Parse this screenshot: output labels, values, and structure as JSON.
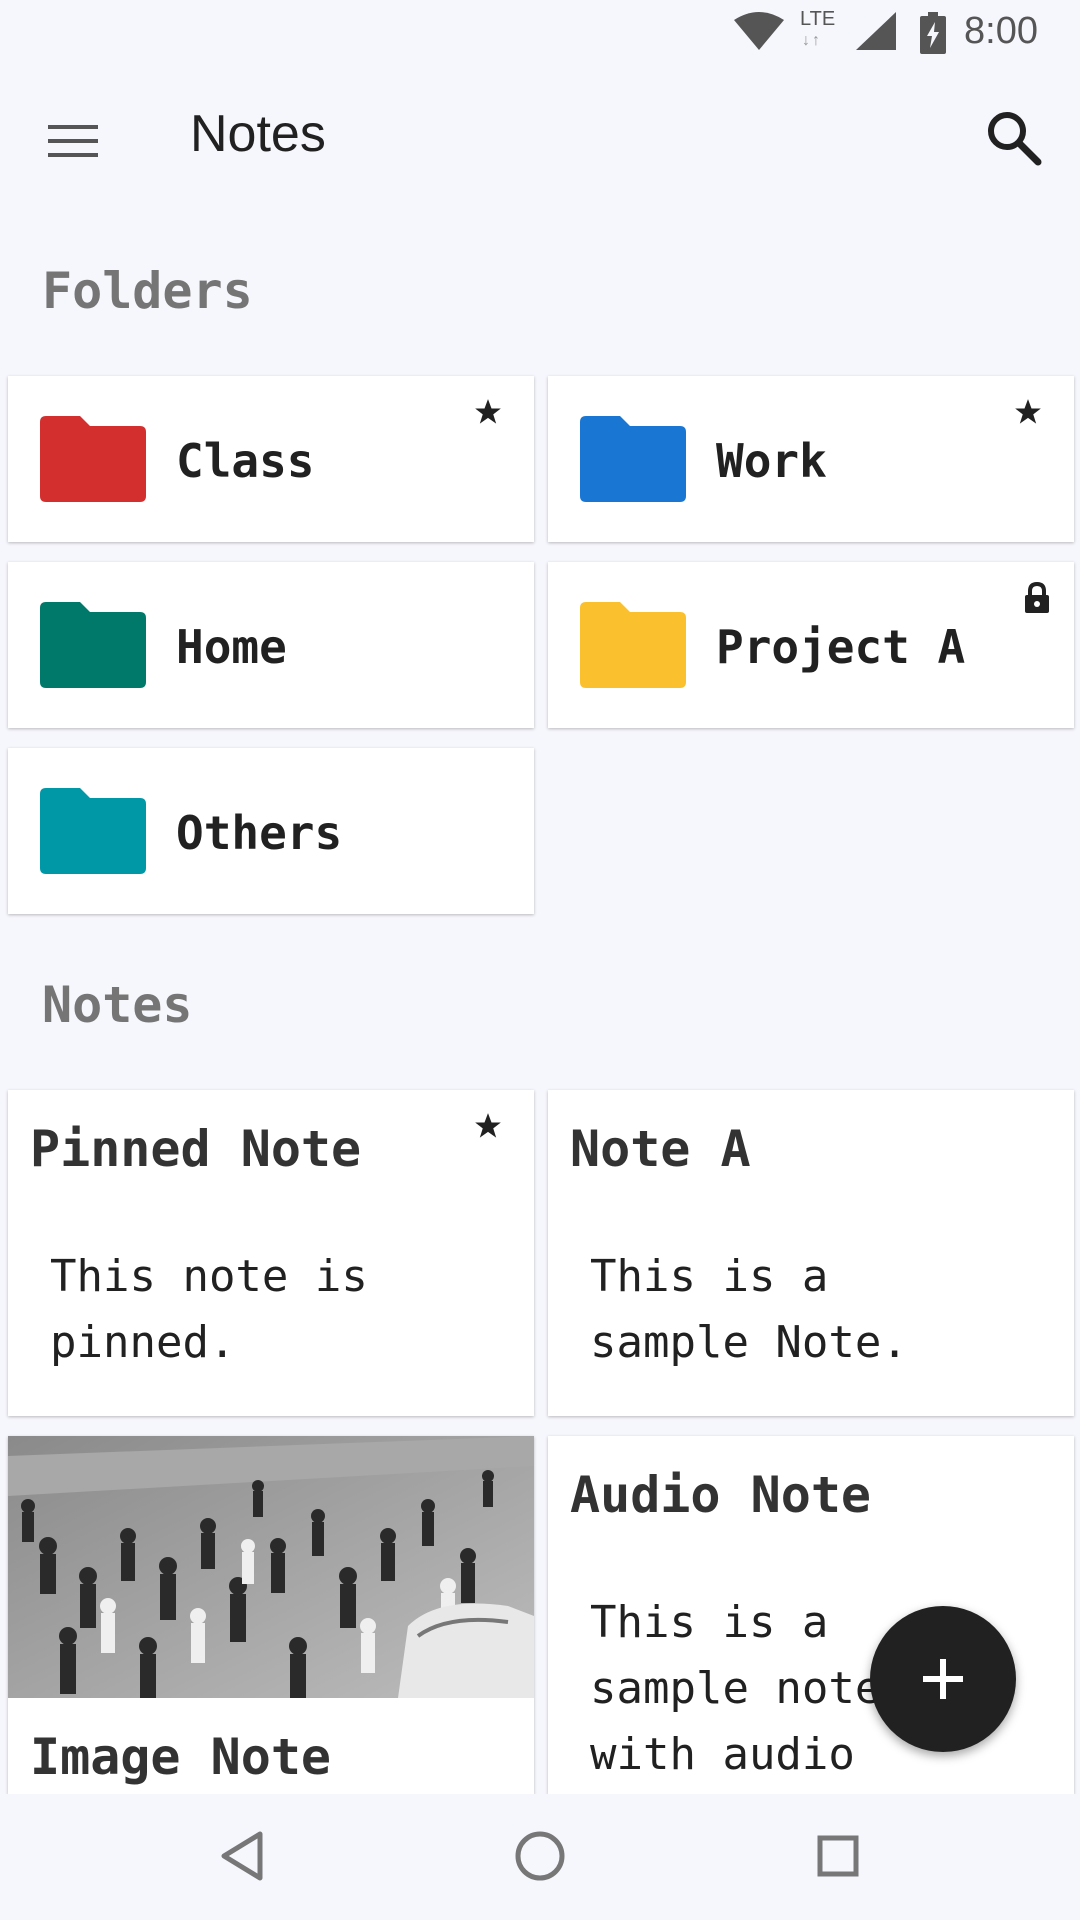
{
  "status_bar": {
    "network_label": "LTE",
    "time": "8:00",
    "icons": [
      "wifi-icon",
      "lte-icon",
      "cell-signal-icon",
      "battery-charging-icon"
    ]
  },
  "app_bar": {
    "title": "Notes",
    "menu_icon": "hamburger-menu-icon",
    "search_icon": "search-icon"
  },
  "folders": {
    "header": "Folders",
    "items": [
      {
        "name": "Class",
        "color": "#d32f2f",
        "badge": "star-icon"
      },
      {
        "name": "Work",
        "color": "#1976d2",
        "badge": "star-icon"
      },
      {
        "name": "Home",
        "color": "#00796b",
        "badge": ""
      },
      {
        "name": "Project A",
        "color": "#fbc02d",
        "badge": "lock-icon"
      },
      {
        "name": "Others",
        "color": "#0097a7",
        "badge": ""
      }
    ]
  },
  "notes": {
    "header": "Notes",
    "items": [
      {
        "title": "Pinned Note",
        "body": "This note is\npinned.",
        "badge": "star-icon"
      },
      {
        "title": "Note A",
        "body": "This is a\nsample Note."
      },
      {
        "title": "Image Note",
        "image": "crowd-photo"
      },
      {
        "title": "Audio Note",
        "body": "This is a\nsample note\nwith audio"
      }
    ]
  },
  "fab": {
    "icon": "plus-icon"
  },
  "nav_bar": {
    "icons": [
      "back-icon",
      "home-icon",
      "recents-icon"
    ]
  }
}
